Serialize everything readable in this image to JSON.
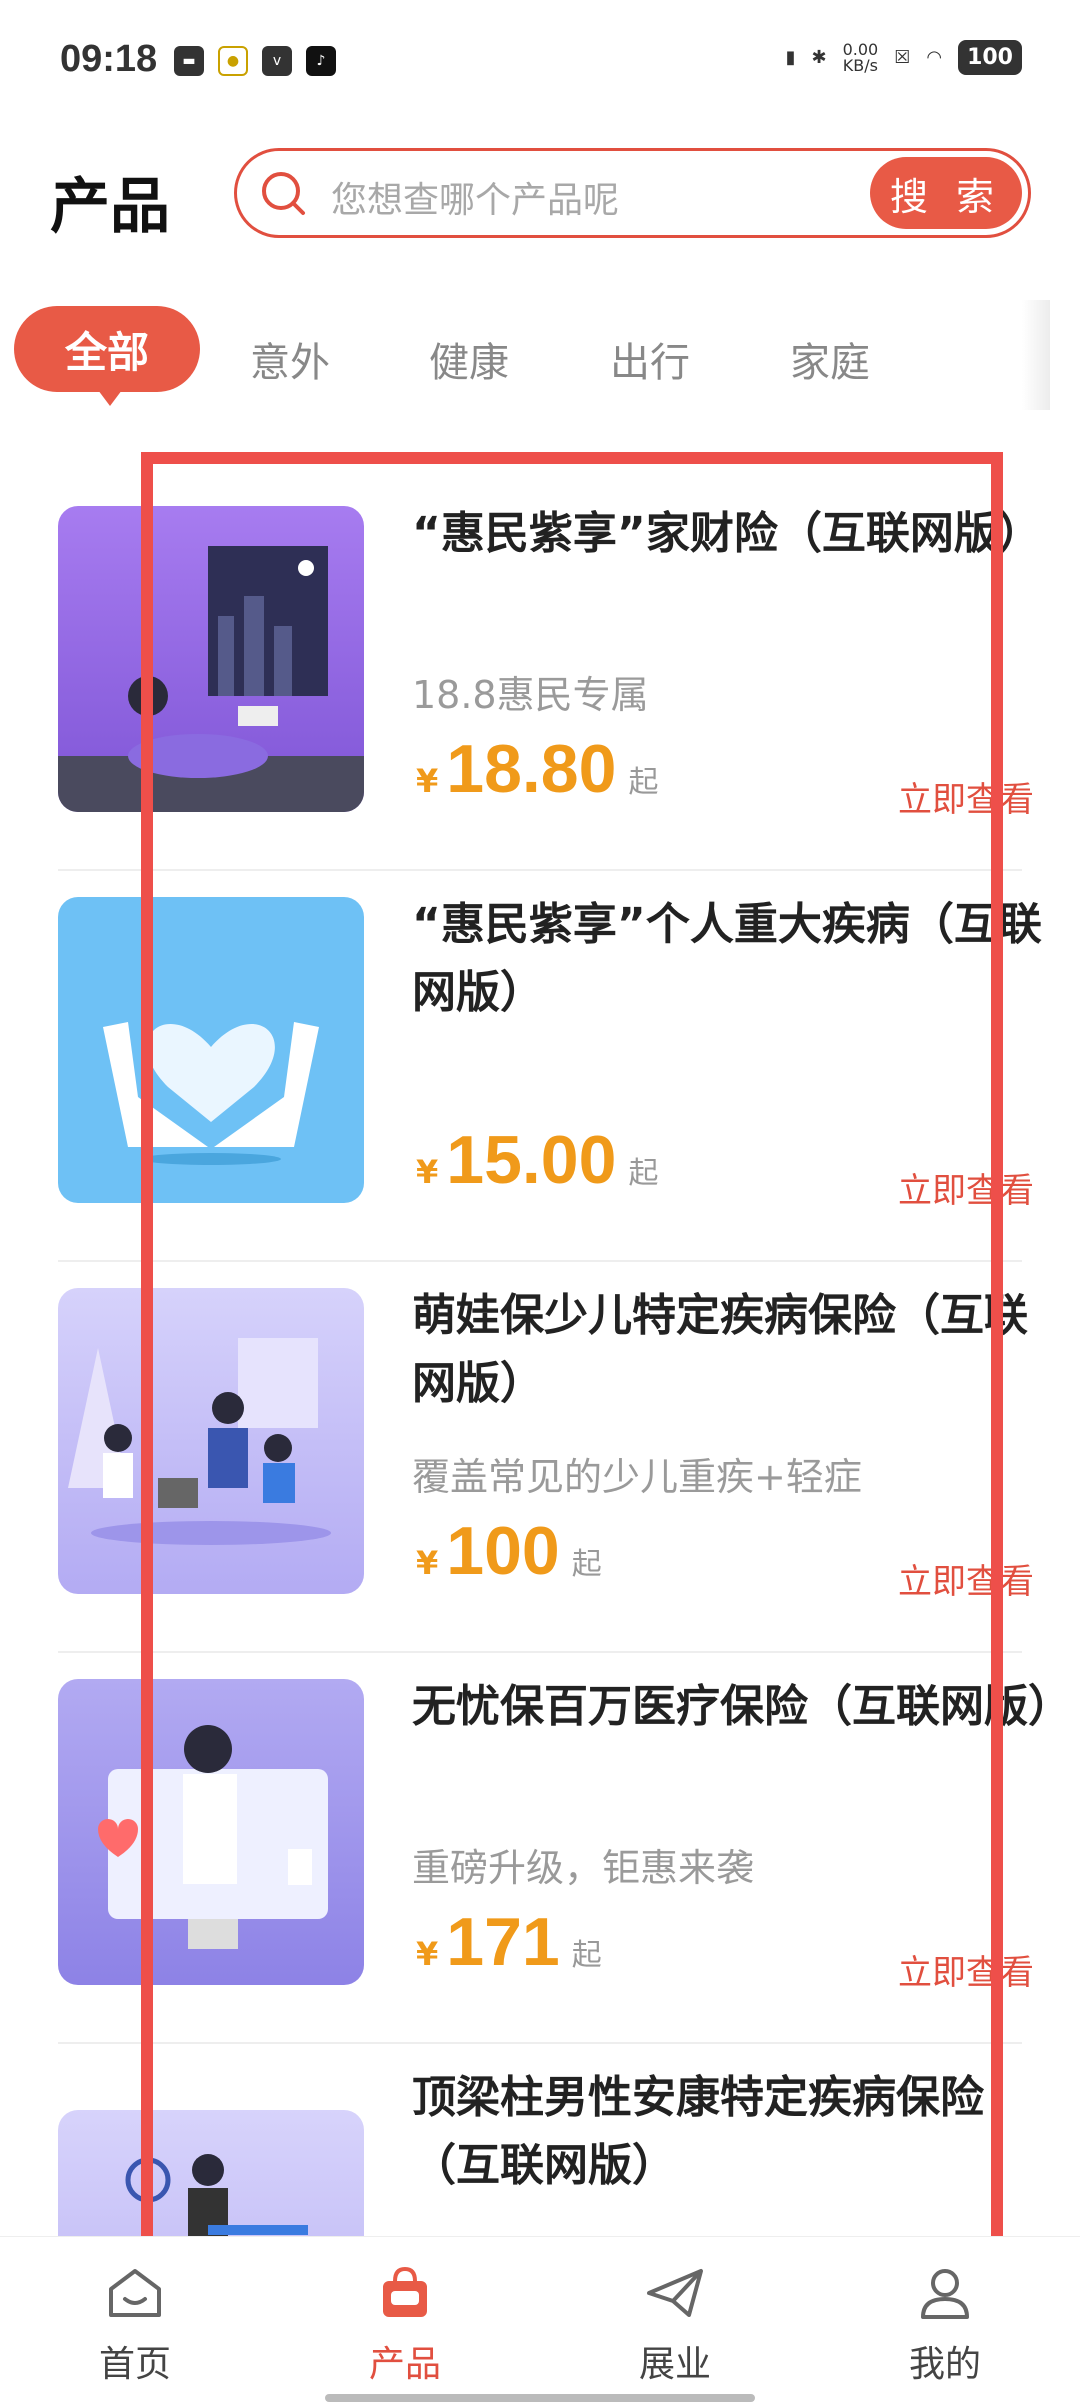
{
  "status_bar": {
    "time": "09:18",
    "network_speed": "0.00\nKB/s",
    "battery": "100"
  },
  "header": {
    "title": "产品",
    "search_placeholder": "您想查哪个产品呢",
    "search_button": "搜 索"
  },
  "tabs": {
    "active": "全部",
    "items": [
      "意外",
      "健康",
      "出行",
      "家庭"
    ]
  },
  "products": [
    {
      "title": "“惠民紫享”家财险（互联网版）",
      "subtitle": "18.8惠民专属",
      "currency": "¥",
      "price": "18.80",
      "suffix": "起",
      "action": "立即查看"
    },
    {
      "title": "“惠民紫享”个人重大疾病（互联网版）",
      "subtitle": "",
      "currency": "¥",
      "price": "15.00",
      "suffix": "起",
      "action": "立即查看"
    },
    {
      "title": "萌娃保少儿特定疾病保险（互联网版）",
      "subtitle": "覆盖常见的少儿重疾+轻症",
      "currency": "¥",
      "price": "100",
      "suffix": "起",
      "action": "立即查看"
    },
    {
      "title": "无忧保百万医疗保险（互联网版）",
      "subtitle": "重磅升级，钜惠来袭",
      "currency": "¥",
      "price": "171",
      "suffix": "起",
      "action": "立即查看"
    },
    {
      "title": "顶梁柱男性安康特定疾病保险（互联网版）",
      "subtitle": "",
      "currency": "",
      "price": "",
      "suffix": "",
      "action": ""
    }
  ],
  "bottom_nav": [
    {
      "label": "首页"
    },
    {
      "label": "产品"
    },
    {
      "label": "展业"
    },
    {
      "label": "我的"
    }
  ],
  "colors": {
    "accent": "#e85a46",
    "price": "#f09a1a",
    "highlight_box": "#ee4f4a"
  }
}
